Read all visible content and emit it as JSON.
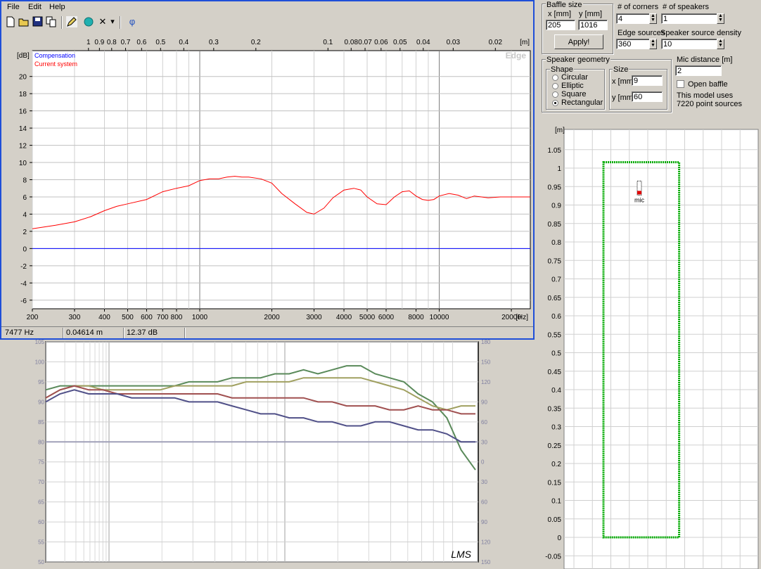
{
  "menu": {
    "file": "File",
    "edit": "Edit",
    "help": "Help"
  },
  "toolbar_icons": [
    "new-file-icon",
    "open-folder-icon",
    "save-icon",
    "copy-icon",
    "pencil-icon",
    "teal-icon",
    "close-x-icon",
    "dropdown-icon",
    "phi-icon"
  ],
  "toolbar_glyphs": {
    "close": "✕",
    "dropdown": "▾",
    "phi": "φ"
  },
  "status": {
    "freq": "7477 Hz",
    "dist": "0.04614 m",
    "level": "12.37 dB"
  },
  "plot": {
    "y_unit": "[dB]",
    "top_unit": "[m]",
    "x_unit": "[Hz]",
    "watermark": "Edge",
    "legend": [
      "Compensation",
      "Current system"
    ],
    "colors": {
      "compensation": "#0000ff",
      "current": "#ff0000"
    }
  },
  "chart_data": [
    {
      "type": "line",
      "title": "",
      "xscale": "log",
      "xlim": [
        200,
        24000
      ],
      "ylim": [
        -7,
        23
      ],
      "x_ticks": [
        200,
        300,
        400,
        500,
        600,
        700,
        800,
        1000,
        2000,
        3000,
        4000,
        5000,
        6000,
        8000,
        10000,
        20000
      ],
      "x_tick_labels": [
        "200",
        "300",
        "400",
        "500",
        "600",
        "700",
        "800",
        "1000",
        "2000",
        "3000",
        "4000",
        "5000",
        "6000",
        "8000",
        "10000",
        "20000"
      ],
      "y_ticks": [
        -6,
        -4,
        -2,
        0,
        2,
        4,
        6,
        8,
        10,
        12,
        14,
        16,
        18,
        20
      ],
      "top_ticks_m": [
        1,
        0.9,
        0.8,
        0.7,
        0.6,
        0.5,
        0.4,
        0.3,
        0.2,
        0.1,
        0.08,
        0.07,
        0.06,
        0.05,
        0.04,
        0.03,
        0.02
      ],
      "top_tick_labels": [
        "1",
        "0.9",
        "0.8",
        "0.7",
        "0.6",
        "0.5",
        "0.4",
        "0.3",
        "0.2",
        "0.1",
        "0.08",
        "0.07",
        "0.06",
        "0.05",
        "0.04",
        "0.03",
        "0.02"
      ],
      "series": [
        {
          "name": "Compensation",
          "x": [
            200,
            24000
          ],
          "y": [
            0,
            0
          ]
        },
        {
          "name": "Current system",
          "x": [
            200,
            250,
            300,
            350,
            400,
            450,
            500,
            600,
            700,
            800,
            900,
            1000,
            1100,
            1200,
            1300,
            1400,
            1500,
            1600,
            1800,
            2000,
            2200,
            2500,
            2800,
            3000,
            3300,
            3600,
            4000,
            4400,
            4700,
            5000,
            5500,
            6000,
            6500,
            7000,
            7500,
            8000,
            8500,
            9000,
            9500,
            10000,
            11000,
            12000,
            13000,
            14000,
            15000,
            16000,
            18000,
            20000,
            24000
          ],
          "y": [
            2.3,
            2.7,
            3.1,
            3.7,
            4.4,
            4.9,
            5.2,
            5.7,
            6.6,
            7.0,
            7.3,
            7.9,
            8.1,
            8.1,
            8.3,
            8.4,
            8.3,
            8.3,
            8.1,
            7.6,
            6.4,
            5.2,
            4.2,
            4.0,
            4.7,
            5.9,
            6.8,
            7.0,
            6.8,
            6.0,
            5.2,
            5.1,
            6.0,
            6.6,
            6.7,
            6.1,
            5.7,
            5.6,
            5.7,
            6.1,
            6.4,
            6.2,
            5.8,
            6.1,
            6.0,
            5.9,
            6.0,
            6.0,
            6.0
          ]
        }
      ]
    },
    {
      "type": "line",
      "title": "",
      "watermark": "LMS",
      "ylim": [
        50,
        105
      ],
      "y_ticks": [
        50,
        55,
        60,
        65,
        70,
        75,
        80,
        85,
        90,
        95,
        100,
        105
      ],
      "y2_ticks": [
        180,
        150,
        120,
        90,
        60,
        30,
        0,
        30,
        60,
        90,
        120,
        150
      ],
      "series": [
        {
          "name": "",
          "color": "#5a8a5a",
          "x": [
            0,
            1,
            2,
            3,
            4,
            5,
            6,
            7,
            8,
            9,
            10,
            11,
            12,
            13,
            14,
            15,
            16,
            17,
            18,
            19,
            20,
            21,
            22,
            23,
            24,
            25,
            26,
            27,
            28,
            29,
            30
          ],
          "y": [
            93,
            94,
            94,
            94,
            94,
            94,
            94,
            94,
            94,
            94,
            95,
            95,
            95,
            96,
            96,
            96,
            97,
            97,
            98,
            97,
            98,
            99,
            99,
            97,
            96,
            95,
            92,
            90,
            86,
            78,
            73
          ]
        },
        {
          "name": "",
          "color": "#a0a060",
          "x": [
            0,
            1,
            2,
            3,
            4,
            5,
            6,
            7,
            8,
            9,
            10,
            11,
            12,
            13,
            14,
            15,
            16,
            17,
            18,
            19,
            20,
            21,
            22,
            23,
            24,
            25,
            26,
            27,
            28,
            29,
            30
          ],
          "y": [
            91,
            93,
            94,
            94,
            93,
            93,
            93,
            93,
            93,
            94,
            94,
            94,
            94,
            94,
            95,
            95,
            95,
            95,
            96,
            96,
            96,
            96,
            96,
            95,
            94,
            93,
            91,
            89,
            88,
            89,
            89
          ]
        },
        {
          "name": "",
          "color": "#a05050",
          "x": [
            0,
            1,
            2,
            3,
            4,
            5,
            6,
            7,
            8,
            9,
            10,
            11,
            12,
            13,
            14,
            15,
            16,
            17,
            18,
            19,
            20,
            21,
            22,
            23,
            24,
            25,
            26,
            27,
            28,
            29,
            30
          ],
          "y": [
            91,
            93,
            94,
            93,
            93,
            92,
            92,
            92,
            92,
            92,
            92,
            92,
            92,
            91,
            91,
            91,
            91,
            91,
            91,
            90,
            90,
            89,
            89,
            89,
            88,
            88,
            89,
            88,
            88,
            87,
            87
          ]
        },
        {
          "name": "",
          "color": "#505088",
          "x": [
            0,
            1,
            2,
            3,
            4,
            5,
            6,
            7,
            8,
            9,
            10,
            11,
            12,
            13,
            14,
            15,
            16,
            17,
            18,
            19,
            20,
            21,
            22,
            23,
            24,
            25,
            26,
            27,
            28,
            29,
            30
          ],
          "y": [
            90,
            92,
            93,
            92,
            92,
            92,
            91,
            91,
            91,
            91,
            90,
            90,
            90,
            89,
            88,
            87,
            87,
            86,
            86,
            85,
            85,
            84,
            84,
            85,
            85,
            84,
            83,
            83,
            82,
            80,
            80
          ]
        }
      ]
    },
    {
      "type": "scatter",
      "title": "",
      "y_unit": "[m]",
      "ylim": [
        -0.05,
        1.1
      ],
      "y_ticks": [
        -0.05,
        0,
        0.05,
        0.1,
        0.15,
        0.2,
        0.25,
        0.3,
        0.35,
        0.4,
        0.45,
        0.5,
        0.55,
        0.6,
        0.65,
        0.7,
        0.75,
        0.8,
        0.85,
        0.9,
        0.95,
        1,
        1.05
      ],
      "y_tick_labels": [
        "-0.05",
        "0",
        "0.05",
        "0.1",
        "0.15",
        "0.2",
        "0.25",
        "0.3",
        "0.35",
        "0.4",
        "0.45",
        "0.5",
        "0.55",
        "0.6",
        "0.65",
        "0.7",
        "0.75",
        "0.8",
        "0.85",
        "0.9",
        "0.95",
        "1",
        "1.05"
      ],
      "baffle": {
        "x_m": 0.205,
        "y_m": 1.016,
        "color": "#00aa00"
      },
      "mic_label": "mic"
    }
  ],
  "panel": {
    "baffle_size": "Baffle size",
    "x_mm_label": "x [mm]",
    "y_mm_label": "y [mm]",
    "x_mm_value": "205",
    "y_mm_value": "1016",
    "apply": "Apply!",
    "corners_label": "# of corners",
    "corners_value": "4",
    "speakers_label": "# of speakers",
    "speakers_value": "1",
    "edge_sources_label": "Edge sources",
    "edge_sources_value": "360",
    "density_label": "Speaker source density",
    "density_value": "10",
    "geometry_label": "Speaker geometry",
    "shape_label": "Shape",
    "shapes": [
      "Circular",
      "Elliptic",
      "Square",
      "Rectangular"
    ],
    "size_label": "Size",
    "size_x_label": "x [mm]",
    "size_x_value": "9",
    "size_y_label": "y [mm]",
    "size_y_value": "60",
    "mic_distance_label": "Mic distance [m]",
    "mic_distance_value": "2",
    "open_baffle_label": "Open baffle",
    "model_note_1": "This model uses",
    "model_note_2": "7220 point sources"
  }
}
